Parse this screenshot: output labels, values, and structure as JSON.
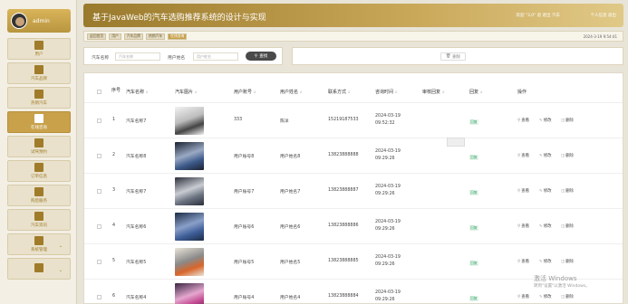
{
  "user": {
    "name": "admin"
  },
  "sidebar": {
    "items": [
      {
        "label": "用户",
        "icon": "chart-icon"
      },
      {
        "label": "汽车品牌",
        "icon": "chat-icon"
      },
      {
        "label": "热销汽车",
        "icon": "book-icon"
      },
      {
        "label": "在线咨询",
        "icon": "clipboard-icon"
      },
      {
        "label": "试驾预约",
        "icon": "briefcase-icon"
      },
      {
        "label": "订单信息",
        "icon": "grid-icon"
      },
      {
        "label": "购后服务",
        "icon": "easel-icon"
      },
      {
        "label": "汽车资讯",
        "icon": "paper-plane-icon"
      },
      {
        "label": "系统管理",
        "icon": "person-icon"
      },
      {
        "label": "",
        "icon": "card-icon"
      }
    ]
  },
  "header": {
    "title": "基于JavaWeb的汽车选购推荐系统的设计与实现",
    "links": "欢迎 \"3,0\" 退 退出 汽车",
    "right": "个人信息 退出"
  },
  "breadcrumb": {
    "items": [
      "返回首页",
      "用户",
      "汽车品牌",
      "热销汽车",
      "在线咨询"
    ],
    "time": "2024-3-19 9:54:41"
  },
  "search": {
    "car_label": "汽车名称",
    "car_placeholder": "汽车名称",
    "user_label": "用户姓名",
    "user_placeholder": "用户姓名",
    "button": "查找"
  },
  "toolbar": {
    "delete": "删除"
  },
  "table": {
    "headers": [
      "序号",
      "汽车名称",
      "汽车图片",
      "用户账号",
      "用户姓名",
      "联系方式",
      "咨询时间",
      "审核回复",
      "回复",
      "操作"
    ],
    "rows": [
      {
        "no": "1",
        "car": "汽车名称7",
        "account": "333",
        "name": "陈洋",
        "phone": "15219187533",
        "time": "2024-03-19 09:52:32",
        "reply": "回复"
      },
      {
        "no": "2",
        "car": "汽车名称8",
        "account": "用户账号8",
        "name": "用户姓名8",
        "phone": "13823888888",
        "time": "2024-03-19 09:29:26",
        "reply": "回复"
      },
      {
        "no": "3",
        "car": "汽车名称7",
        "account": "用户账号7",
        "name": "用户姓名7",
        "phone": "13823888887",
        "time": "2024-03-19 09:29:26",
        "reply": "回复"
      },
      {
        "no": "4",
        "car": "汽车名称6",
        "account": "用户账号6",
        "name": "用户姓名6",
        "phone": "13823888886",
        "time": "2024-03-19 09:29:26",
        "reply": "回复"
      },
      {
        "no": "5",
        "car": "汽车名称5",
        "account": "用户账号5",
        "name": "用户姓名5",
        "phone": "13823888885",
        "time": "2024-03-19 09:29:26",
        "reply": "回复"
      },
      {
        "no": "6",
        "car": "汽车名称4",
        "account": "用户账号4",
        "name": "用户姓名4",
        "phone": "13823888884",
        "time": "2024-03-19 09:29:26",
        "reply": "回复"
      }
    ],
    "actions": {
      "view": "查看",
      "edit": "修改",
      "delete": "删除"
    }
  },
  "watermark": {
    "line1": "激活 Windows",
    "line2": "转到\"设置\"以激活 Windows。"
  },
  "colors": {
    "accent": "#c8a14a",
    "header_dark": "#9a7a2c",
    "reply_green": "#3aa56a"
  }
}
